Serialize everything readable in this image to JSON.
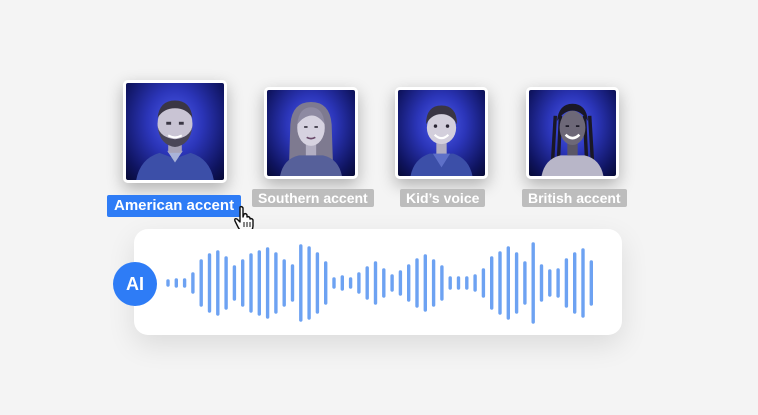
{
  "voices": [
    {
      "label": "American accent",
      "selected": true
    },
    {
      "label": "Southern accent",
      "selected": false
    },
    {
      "label": "Kid’s voice",
      "selected": false
    },
    {
      "label": "British accent",
      "selected": false
    }
  ],
  "ai_badge": "AI",
  "colors": {
    "accent": "#2e7cf6",
    "wave": "#6da2f2",
    "label_inactive": "#bdbdbd"
  },
  "icons": {
    "cursor": "hand-pointer-icon"
  }
}
